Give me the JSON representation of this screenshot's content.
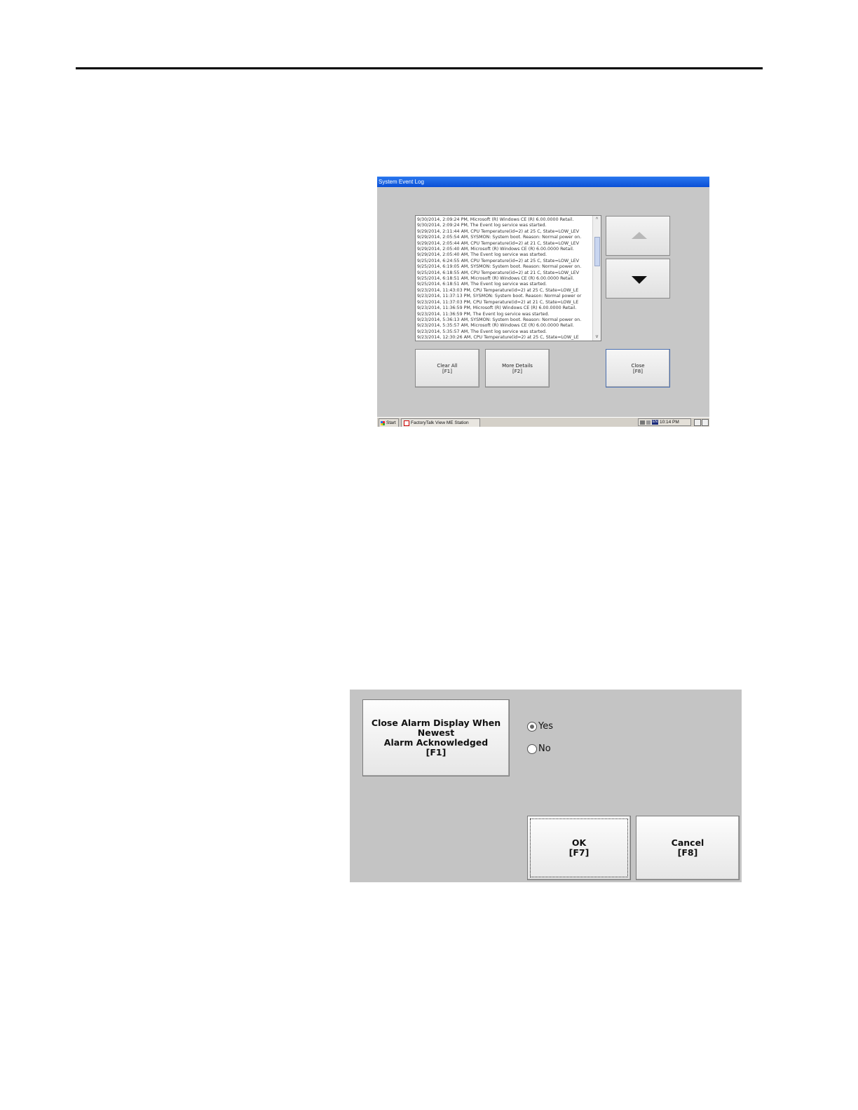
{
  "event_log_window": {
    "title": "System Event Log",
    "log_entries": [
      "9/30/2014, 2:09:24 PM, Microsoft (R) Windows CE (R) 6.00.0000 Retail.",
      "9/30/2014, 2:09:24 PM, The Event log service was started.",
      "9/29/2014, 2:11:44 AM, CPU Temperature(id=2) at 25 C, State=LOW_LEV",
      "9/29/2014, 2:05:54 AM, SYSMON: System boot. Reason: Normal power on.",
      "9/29/2014, 2:05:44 AM, CPU Temperature(id=2) at 21 C, State=LOW_LEV",
      "9/29/2014, 2:05:40 AM, Microsoft (R) Windows CE (R) 6.00.0000 Retail.",
      "9/29/2014, 2:05:40 AM, The Event log service was started.",
      "9/25/2014, 6:24:55 AM, CPU Temperature(id=2) at 25 C, State=LOW_LEV",
      "9/25/2014, 6:19:05 AM, SYSMON: System boot. Reason: Normal power on.",
      "9/25/2014, 6:18:55 AM, CPU Temperature(id=2) at 21 C, State=LOW_LEV",
      "9/25/2014, 6:18:51 AM, Microsoft (R) Windows CE (R) 6.00.0000 Retail.",
      "9/25/2014, 6:18:51 AM, The Event log service was started.",
      "9/23/2014, 11:43:03 PM, CPU Temperature(id=2) at 25 C, State=LOW_LE",
      "9/23/2014, 11:37:13 PM, SYSMON: System boot. Reason: Normal power or",
      "9/23/2014, 11:37:03 PM, CPU Temperature(id=2) at 21 C, State=LOW_LE",
      "9/23/2014, 11:36:59 PM, Microsoft (R) Windows CE (R) 6.00.0000 Retail.",
      "9/23/2014, 11:36:59 PM, The Event log service was started.",
      "9/23/2014, 5:36:13 AM, SYSMON: System boot. Reason: Normal power on.",
      "9/23/2014, 5:35:57 AM, Microsoft (R) Windows CE (R) 6.00.0000 Retail.",
      "9/23/2014, 5:35:57 AM, The Event log service was started.",
      "9/23/2014, 12:30:26 AM, CPU Temperature(id=2) at 25 C, State=LOW_LE"
    ],
    "scrollbar": {
      "up": "^",
      "down": "v"
    },
    "buttons": {
      "clear_all": {
        "label": "Clear All",
        "key": "[F1]"
      },
      "more_details": {
        "label": "More Details",
        "key": "[F2]"
      },
      "close": {
        "label": "Close",
        "key": "[F8]"
      }
    },
    "taskbar": {
      "start_label": "Start",
      "task_label": "FactoryTalk View ME Station",
      "keyboard_badge": "EN",
      "clock": "10:14 PM"
    }
  },
  "alarm_dialog": {
    "option_button": {
      "line1": "Close Alarm Display When Newest",
      "line2": "Alarm Acknowledged",
      "key": "[F1]"
    },
    "options": [
      {
        "label": "Yes",
        "checked": true
      },
      {
        "label": "No",
        "checked": false
      }
    ],
    "ok": {
      "label": "OK",
      "key": "[F7]"
    },
    "cancel": {
      "label": "Cancel",
      "key": "[F8]"
    }
  }
}
